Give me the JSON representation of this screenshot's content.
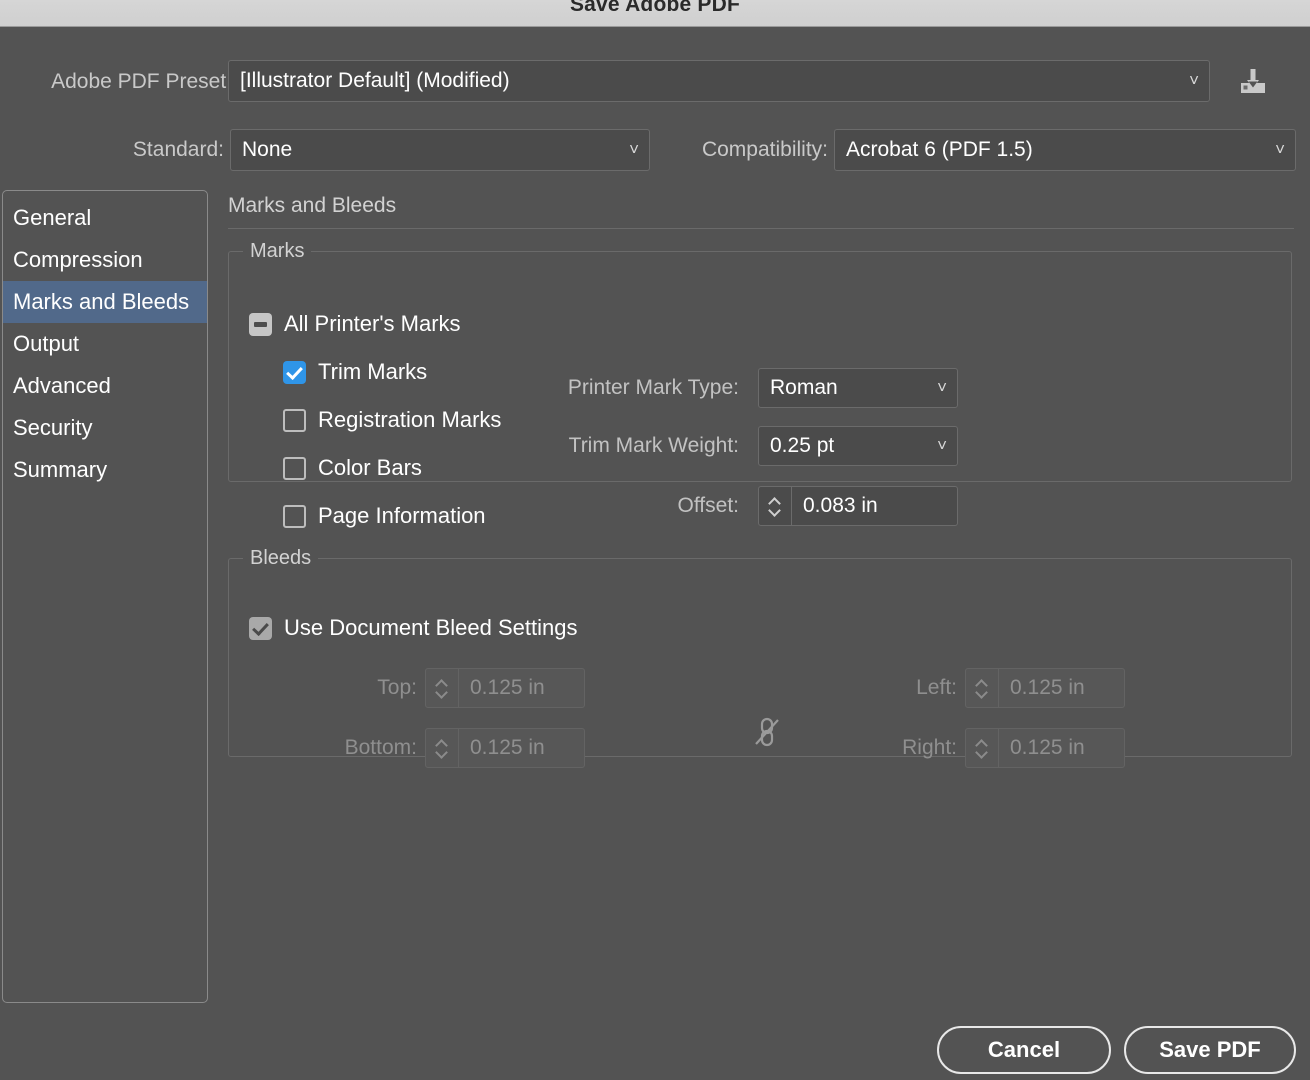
{
  "window": {
    "title": "Save Adobe PDF"
  },
  "top": {
    "preset_label": "Adobe PDF Preset:",
    "preset_value": "[Illustrator Default] (Modified)",
    "save_preset_icon": "save-preset-icon",
    "standard_label": "Standard:",
    "standard_value": "None",
    "compatibility_label": "Compatibility:",
    "compatibility_value": "Acrobat 6 (PDF 1.5)"
  },
  "sidebar": {
    "items": [
      {
        "label": "General",
        "selected": false
      },
      {
        "label": "Compression",
        "selected": false
      },
      {
        "label": "Marks and Bleeds",
        "selected": true
      },
      {
        "label": "Output",
        "selected": false
      },
      {
        "label": "Advanced",
        "selected": false
      },
      {
        "label": "Security",
        "selected": false
      },
      {
        "label": "Summary",
        "selected": false
      }
    ]
  },
  "main": {
    "pane_title": "Marks and Bleeds",
    "marks": {
      "legend": "Marks",
      "all_printers_marks": {
        "label": "All Printer's Marks",
        "state": "indeterminate"
      },
      "checkboxes": [
        {
          "label": "Trim Marks",
          "state": "checked"
        },
        {
          "label": "Registration Marks",
          "state": "unchecked"
        },
        {
          "label": "Color Bars",
          "state": "unchecked"
        },
        {
          "label": "Page Information",
          "state": "unchecked"
        }
      ],
      "printer_mark_type": {
        "label": "Printer Mark Type:",
        "value": "Roman"
      },
      "trim_mark_weight": {
        "label": "Trim Mark Weight:",
        "value": "0.25 pt"
      },
      "offset": {
        "label": "Offset:",
        "value": "0.083 in"
      }
    },
    "bleeds": {
      "legend": "Bleeds",
      "use_document_bleed": {
        "label": "Use Document Bleed Settings",
        "state": "checked"
      },
      "link_icon": "link-off-icon",
      "fields": [
        {
          "label": "Top:",
          "value": "0.125 in",
          "disabled": true
        },
        {
          "label": "Bottom:",
          "value": "0.125 in",
          "disabled": true
        },
        {
          "label": "Left:",
          "value": "0.125 in",
          "disabled": true
        },
        {
          "label": "Right:",
          "value": "0.125 in",
          "disabled": true
        }
      ]
    }
  },
  "footer": {
    "cancel_label": "Cancel",
    "save_label": "Save PDF"
  },
  "colors": {
    "dialog_background": "#535353",
    "titlebar_background": "#d6d6d6",
    "selection_blue": "#51698a",
    "checkbox_blue": "#2f95e8",
    "field_background": "#4b4b4b"
  }
}
